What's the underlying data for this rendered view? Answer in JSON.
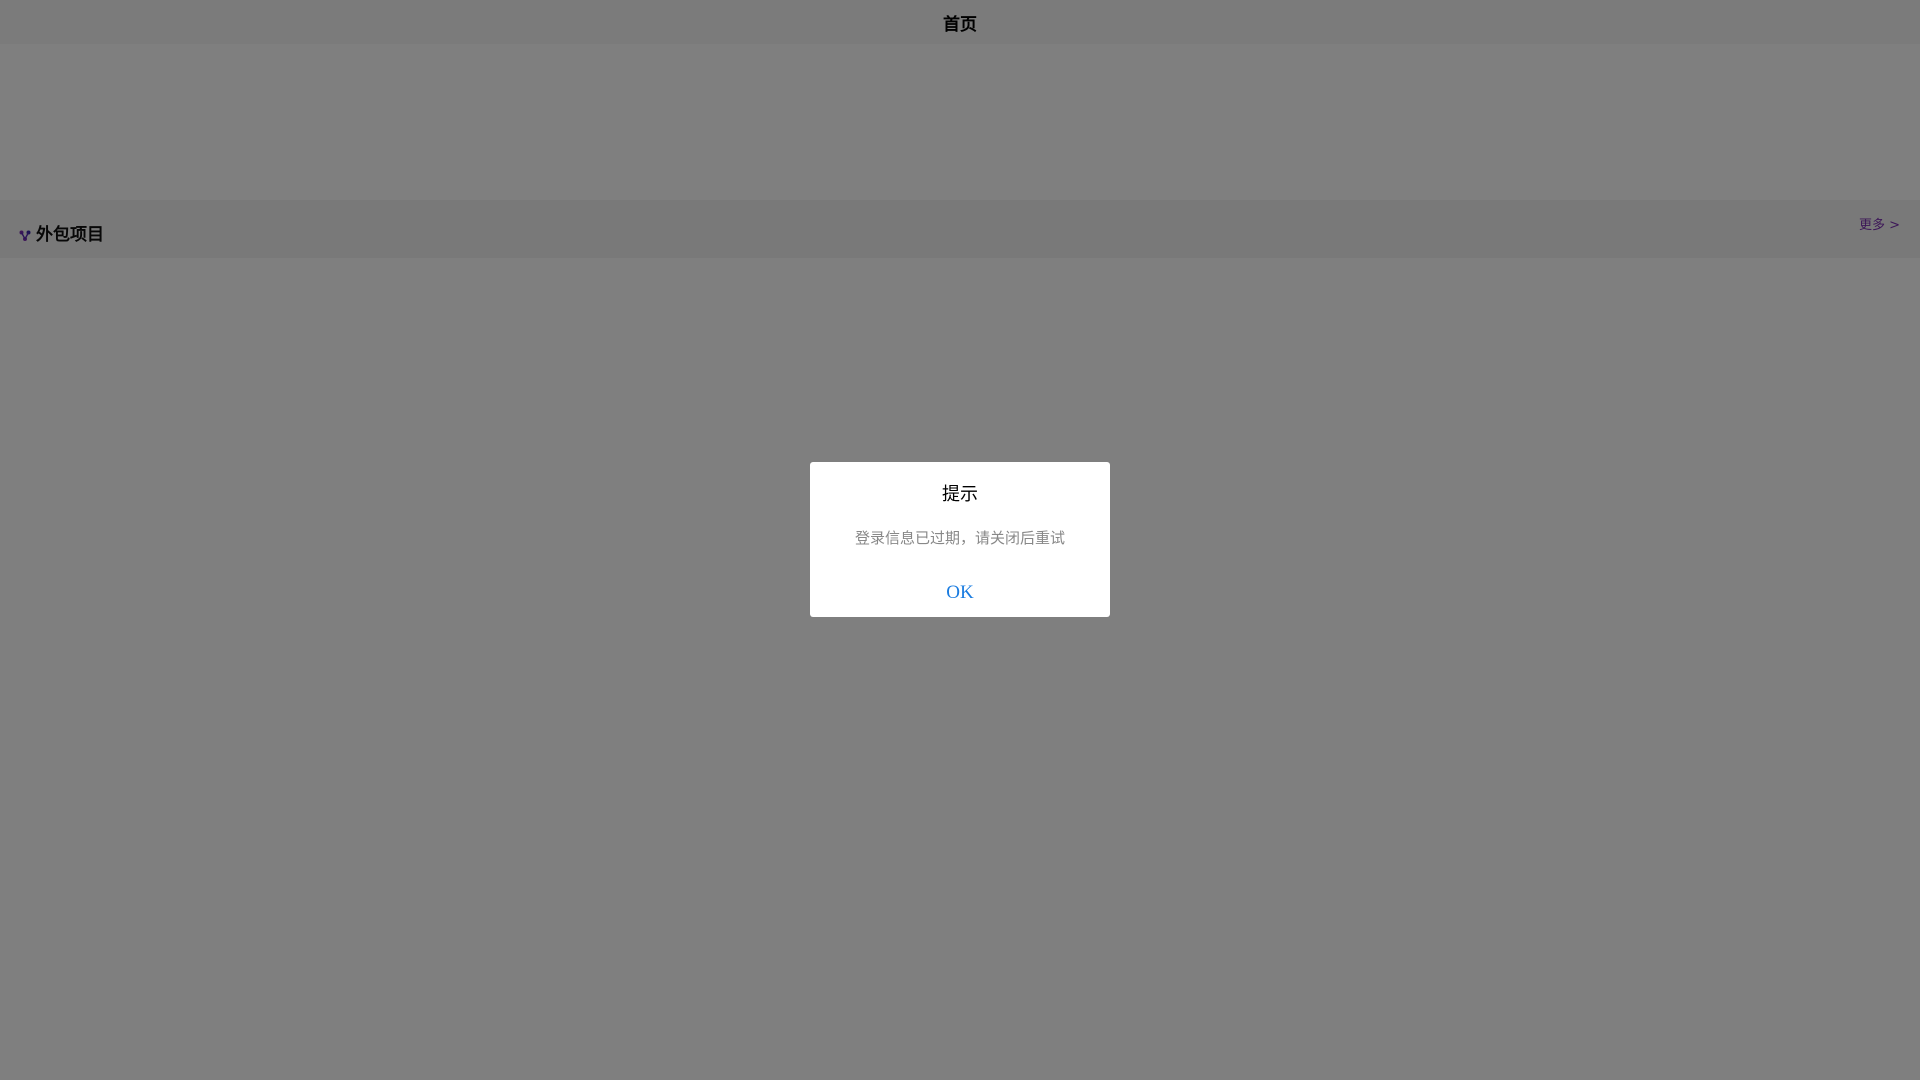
{
  "navbar": {
    "title": "首页"
  },
  "section": {
    "title": "外包项目",
    "more_label": "更多 >",
    "icon": "share-nodes-icon",
    "accent_color": "#7b2fb0"
  },
  "dialog": {
    "title": "提示",
    "message": "登录信息已过期，请关闭后重试",
    "confirm_label": "OK",
    "confirm_color": "#1a7ce0"
  }
}
